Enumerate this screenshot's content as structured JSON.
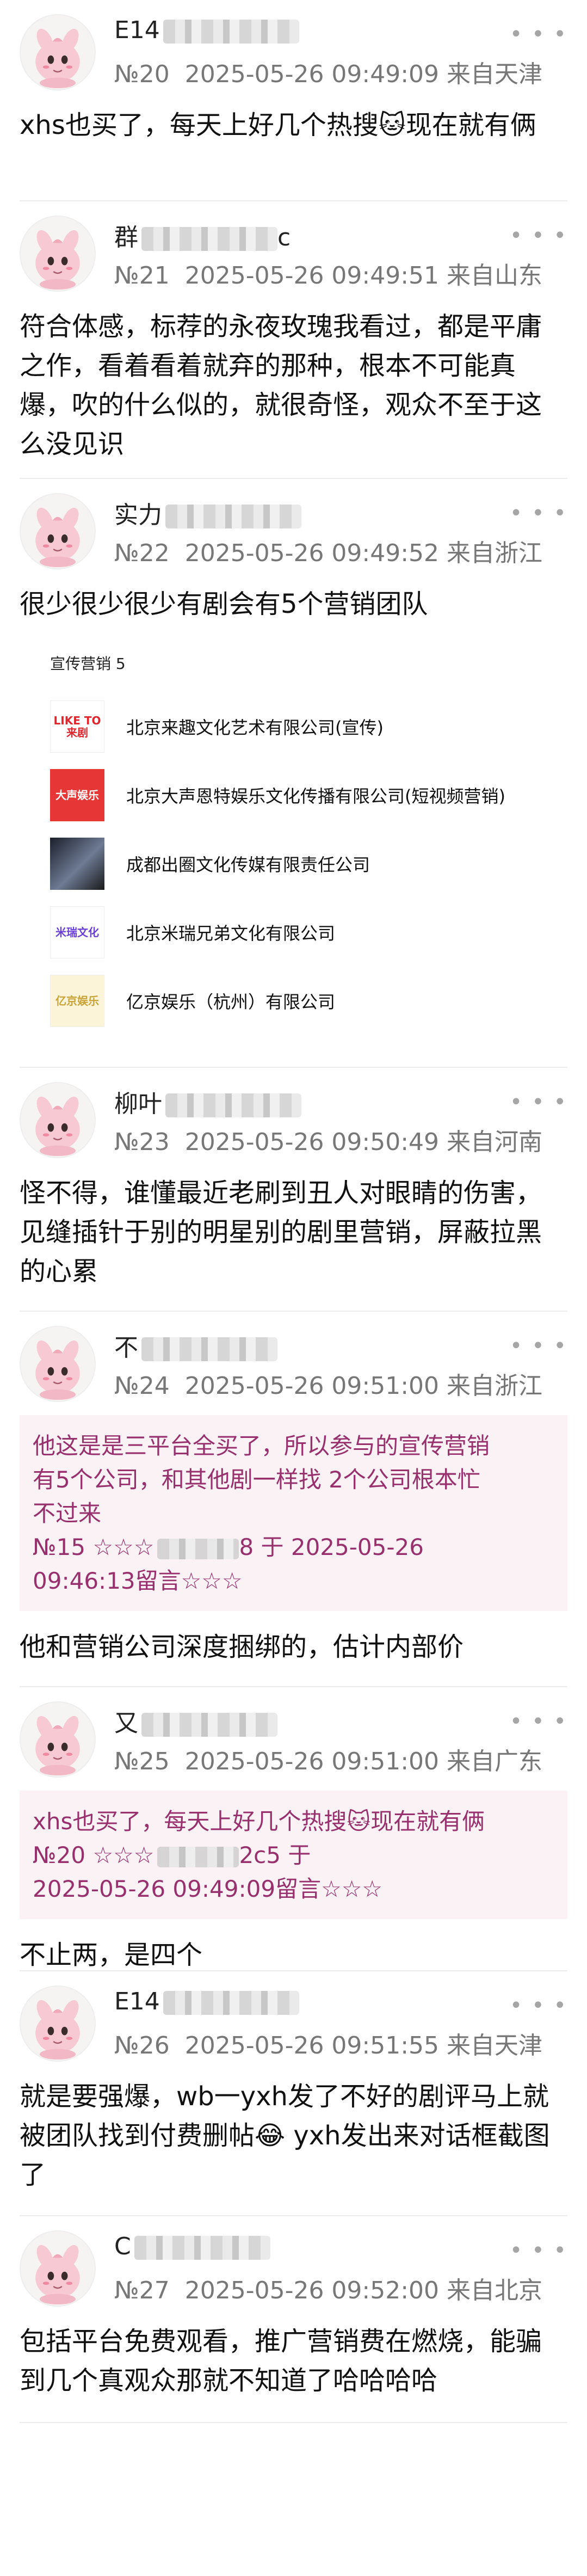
{
  "comments": [
    {
      "name": "E14",
      "floor": "№20",
      "time": "2025-05-26 09:49:09",
      "location": "来自天津",
      "text": "xhs也买了，每天上好几个热搜🐱现在就有俩"
    },
    {
      "name": "群",
      "name_tail": "c",
      "floor": "№21",
      "time": "2025-05-26 09:49:51",
      "location": "来自山东",
      "text": "符合体感，标荐的永夜玫瑰我看过，都是平庸之作，看着看着就弃的那种，根本不可能真爆，吹的什么似的，就很奇怪，观众不至于这么没见识"
    },
    {
      "name": "实力",
      "floor": "№22",
      "time": "2025-05-26 09:49:52",
      "location": "来自浙江",
      "text": "很少很少很少有剧会有5个营销团队"
    },
    {
      "name": "柳叶",
      "floor": "№23",
      "time": "2025-05-26 09:50:49",
      "location": "来自河南",
      "text": "怪不得，谁懂最近老刷到丑人对眼睛的伤害，见缝插针于别的明星别的剧里营销，屏蔽拉黑的心累"
    },
    {
      "name": "不",
      "floor": "№24",
      "time": "2025-05-26 09:51:00",
      "location": "来自浙江",
      "quote_lines": [
        "他这是是三平台全买了，所以参与的宣传营销",
        "有5个公司，和其他剧一样找 2个公司根本忙",
        "不过来"
      ],
      "quote_ref_start": "№15 ☆☆☆",
      "quote_ref_end": "8 于 2025-05-26",
      "quote_ref_time": "09:46:13留言☆☆☆",
      "text": "他和营销公司深度捆绑的，估计内部价"
    },
    {
      "name": "又",
      "floor": "№25",
      "time": "2025-05-26 09:51:00",
      "location": "来自广东",
      "quote_lines": [
        "xhs也买了，每天上好几个热搜🐱现在就有俩"
      ],
      "quote_ref_start": "№20 ☆☆☆",
      "quote_ref_end": "2c5 于",
      "quote_ref_time": "2025-05-26 09:49:09留言☆☆☆",
      "text": "不止两，是四个"
    },
    {
      "name": "E14",
      "floor": "№26",
      "time": "2025-05-26 09:51:55",
      "location": "来自天津",
      "text": "就是要强爆，wb一yxh发了不好的剧评马上就被团队找到付费删帖😂 yxh发出来对话框截图了"
    },
    {
      "name": "C",
      "floor": "№27",
      "time": "2025-05-26 09:52:00",
      "location": "来自北京",
      "text": "包括平台免费观看，推广营销费在燃烧，能骗到几个真观众那就不知道了哈哈哈哈"
    }
  ],
  "promo": {
    "title": "宣传营销  5",
    "items": [
      {
        "logo_text": "LIKE TO 来剧",
        "name": "北京来趣文化艺术有限公司(宣传)"
      },
      {
        "logo_text": "大声娱乐",
        "name": "北京大声恩特娱乐文化传播有限公司(短视频营销)"
      },
      {
        "logo_text": "",
        "name": "成都出圈文化传媒有限责任公司"
      },
      {
        "logo_text": "米瑞文化",
        "name": "北京米瑞兄弟文化有限公司"
      },
      {
        "logo_text": "亿京娱乐",
        "name": "亿京娱乐（杭州）有限公司"
      }
    ]
  },
  "icons": {
    "more": "more-dots-icon",
    "avatar": "avatar-pink-pokemon"
  },
  "colors": {
    "quote_bg": "#fbf2f5",
    "quote_text": "#97306d",
    "meta": "#777777"
  }
}
